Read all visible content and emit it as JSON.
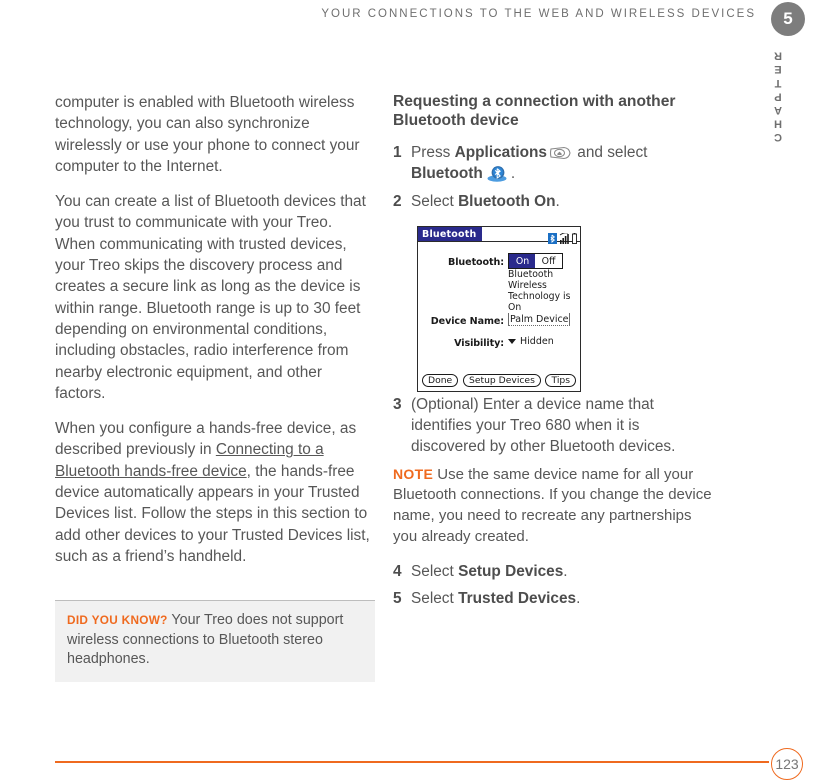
{
  "header": {
    "running_head": "YOUR CONNECTIONS TO THE WEB AND WIRELESS DEVICES",
    "chapter_number": "5",
    "chapter_word": "CHAPTER"
  },
  "left_column": {
    "paragraphs": [
      "computer is enabled with Bluetooth wireless technology, you can also synchronize wirelessly or use your phone to connect your computer to the Internet.",
      "You can create a list of Bluetooth devices that you trust to communicate with your Treo. When communicating with trusted devices, your Treo skips the discovery process and creates a secure link as long as the device is within range. Bluetooth range is up to 30 feet depending on environmental conditions, including obstacles, radio interference from nearby electronic equipment, and other factors."
    ],
    "paragraph3_pre": "When you configure a hands-free device, as described previously in ",
    "paragraph3_link": "Connecting to a Bluetooth hands-free device",
    "paragraph3_post": ", the hands-free device automatically appears in your Trusted Devices list. Follow the steps in this section to add other devices to your Trusted Devices list, such as a friend’s handheld."
  },
  "did_you_know": {
    "label": "DID YOU KNOW?",
    "text": "Your Treo does not support wireless connections to Bluetooth stereo headphones."
  },
  "right_column": {
    "heading": "Requesting a connection with another Bluetooth device",
    "step1": {
      "num": "1",
      "pre": "Press ",
      "bold1": "Applications",
      "mid": " and select ",
      "bold2": "Bluetooth",
      "post": "."
    },
    "step2": {
      "num": "2",
      "pre": "Select ",
      "bold": "Bluetooth On",
      "post": "."
    },
    "step3": {
      "num": "3",
      "text": "(Optional)  Enter a device name that identifies your Treo 680 when it is discovered by other Bluetooth devices."
    },
    "note": {
      "label": "NOTE",
      "text": "Use the same device name for all your Bluetooth connections. If you change the device name, you need to recreate any partnerships you already created."
    },
    "step4": {
      "num": "4",
      "pre": "Select ",
      "bold": "Setup Devices",
      "post": "."
    },
    "step5": {
      "num": "5",
      "pre": "Select ",
      "bold": "Trusted Devices",
      "post": "."
    }
  },
  "device_screenshot": {
    "title": "Bluetooth",
    "label_bluetooth": "Bluetooth:",
    "button_on": "On",
    "button_off": "Off",
    "status_text": "Bluetooth Wireless Technology is On",
    "label_device_name": "Device Name:",
    "device_name_value": "Palm Device",
    "label_visibility": "Visibility:",
    "visibility_value": "Hidden",
    "btn_done": "Done",
    "btn_setup_devices": "Setup Devices",
    "btn_tips": "Tips"
  },
  "footer": {
    "page_number": "123"
  },
  "colors": {
    "accent_orange": "#ef6a1f",
    "body_text": "#575757",
    "heading_text": "#4d4d4d",
    "chapter_badge": "#7d7d7d",
    "palm_titlebar": "#2a2a8c",
    "bluetooth_blue": "#2b7fd4"
  }
}
